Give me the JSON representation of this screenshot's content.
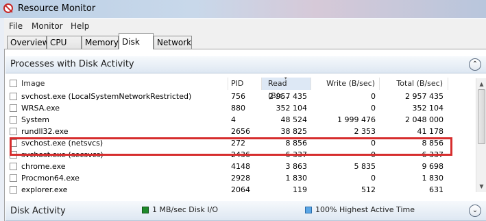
{
  "window": {
    "title": "Resource Monitor"
  },
  "menu": [
    "File",
    "Monitor",
    "Help"
  ],
  "tabs": [
    {
      "label": "Overview",
      "active": false
    },
    {
      "label": "CPU",
      "active": false
    },
    {
      "label": "Memory",
      "active": false
    },
    {
      "label": "Disk",
      "active": true
    },
    {
      "label": "Network",
      "active": false
    }
  ],
  "processes_section": {
    "title": "Processes with Disk Activity",
    "collapse_glyph": "⌃",
    "columns": [
      "Image",
      "PID",
      "Read (B/s...",
      "Write (B/sec)",
      "Total (B/sec)"
    ],
    "sorted_column": "Read (B/s...",
    "rows": [
      {
        "image": "svchost.exe (LocalSystemNetworkRestricted)",
        "pid": "756",
        "read": "2 957 435",
        "write": "0",
        "total": "2 957 435",
        "highlighted": true
      },
      {
        "image": "WRSA.exe",
        "pid": "880",
        "read": "352 104",
        "write": "0",
        "total": "352 104"
      },
      {
        "image": "System",
        "pid": "4",
        "read": "48 524",
        "write": "1 999 476",
        "total": "2 048 000"
      },
      {
        "image": "rundll32.exe",
        "pid": "2656",
        "read": "38 825",
        "write": "2 353",
        "total": "41 178"
      },
      {
        "image": "svchost.exe (netsvcs)",
        "pid": "272",
        "read": "8 856",
        "write": "0",
        "total": "8 856"
      },
      {
        "image": "svchost.exe (secsvcs)",
        "pid": "2436",
        "read": "6 337",
        "write": "0",
        "total": "6 337"
      },
      {
        "image": "chrome.exe",
        "pid": "4148",
        "read": "3 863",
        "write": "5 835",
        "total": "9 698"
      },
      {
        "image": "Procmon64.exe",
        "pid": "2928",
        "read": "1 830",
        "write": "0",
        "total": "1 830"
      },
      {
        "image": "explorer.exe",
        "pid": "2064",
        "read": "119",
        "write": "512",
        "total": "631"
      }
    ]
  },
  "disk_activity_section": {
    "title": "Disk Activity",
    "expand_glyph": "⌄",
    "legend": [
      {
        "label": "1 MB/sec Disk I/O",
        "color": "#1f8a2b"
      },
      {
        "label": "100% Highest Active Time",
        "color": "#5aa6e6"
      }
    ]
  },
  "colors": {
    "highlight_border": "#d62d2d"
  }
}
